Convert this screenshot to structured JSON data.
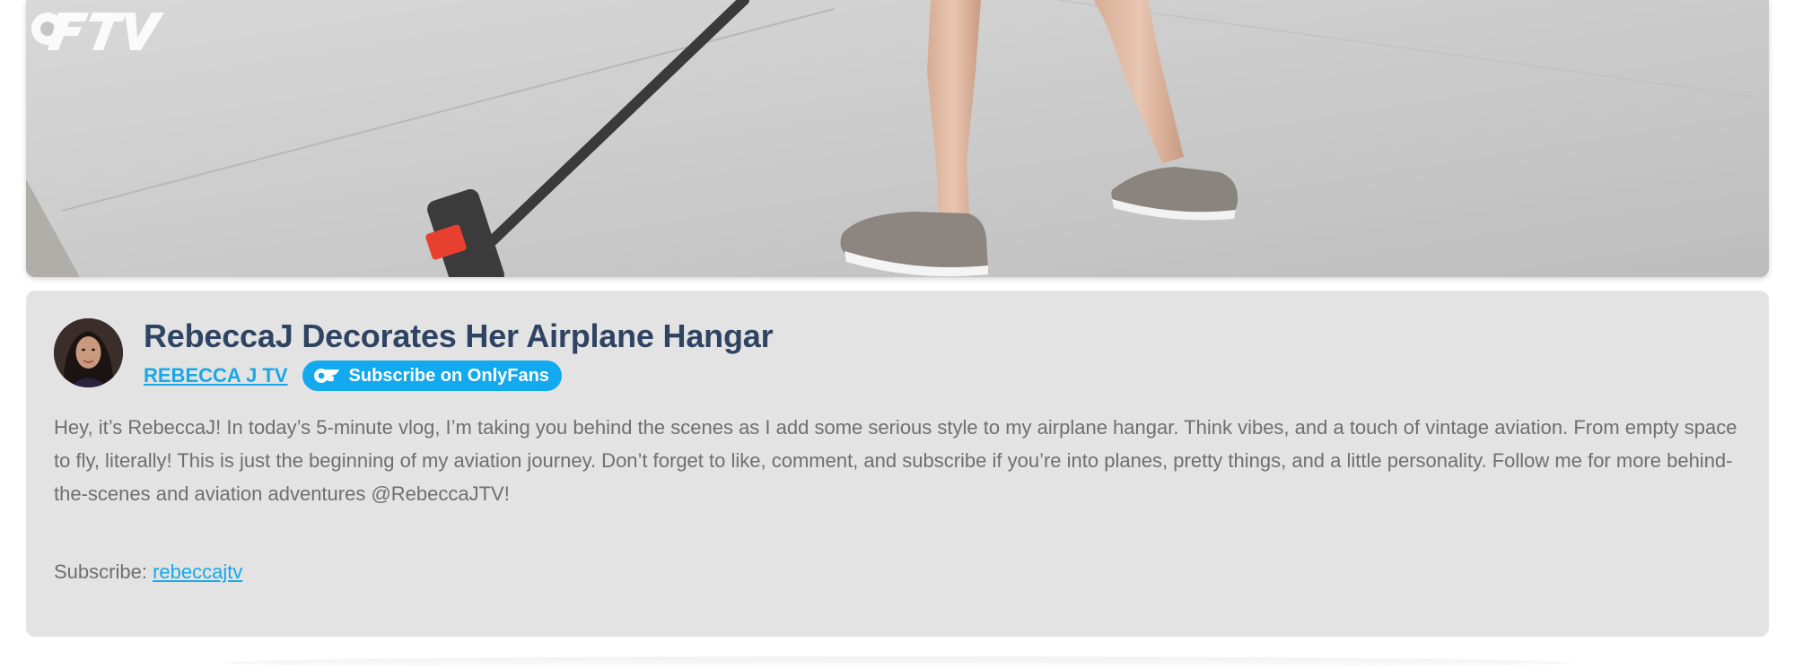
{
  "video": {
    "watermark_icon": "oftv-logo"
  },
  "post": {
    "title": "RebeccaJ Decorates Her Airplane Hangar",
    "channel_name": "REBECCA J TV",
    "subscribe_button_label": "Subscribe on OnlyFans",
    "subscribe_button_icon": "onlyfans-icon",
    "description": "Hey, it’s RebeccaJ! In today’s 5-minute vlog, I’m taking you behind the scenes as I add some serious style to my airplane hangar. Think vibes, and a touch of vintage aviation. From empty space to fly, literally! This is just the beginning of my aviation journey. Don’t forget to like, comment, and subscribe if you’re into planes, pretty things, and a little personality. Follow me for more behind-the-scenes and aviation adventures @RebeccaJTV!",
    "subscribe_prefix": "Subscribe:",
    "subscribe_link": "rebeccajtv"
  },
  "colors": {
    "accent": "#12a9ee",
    "title": "#2e4462",
    "card_bg": "#e3e3e3",
    "body_text": "#6f6f6f"
  }
}
